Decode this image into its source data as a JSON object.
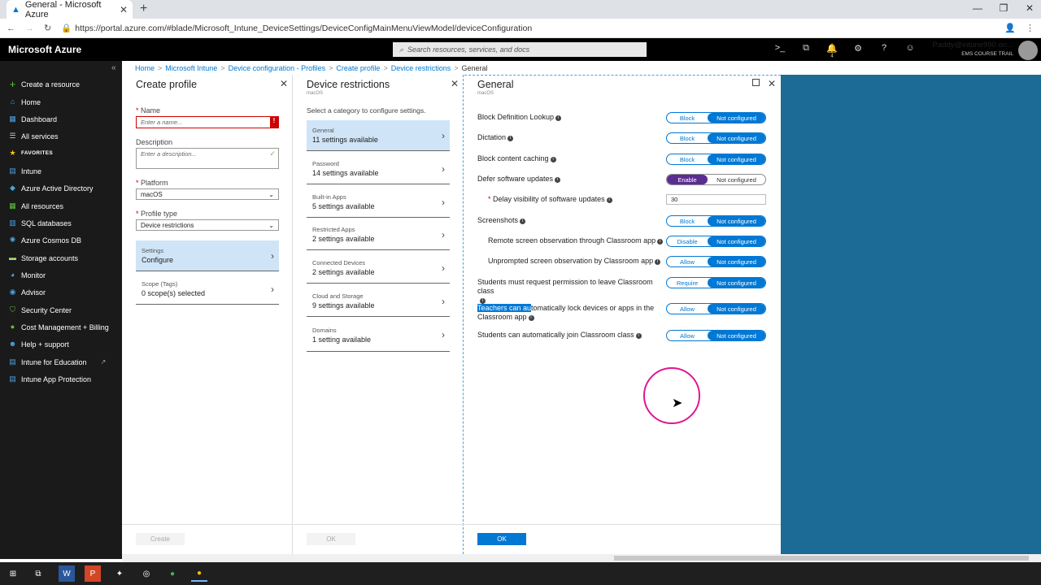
{
  "browser": {
    "tab_title": "General - Microsoft Azure",
    "url": "https://portal.azure.com/#blade/Microsoft_Intune_DeviceSettings/DeviceConfigMainMenuViewModel/deviceConfiguration"
  },
  "topbar": {
    "brand": "Microsoft Azure",
    "search_placeholder": "Search resources, services, and docs",
    "notification_count": "4",
    "user": "Paddy@intune990.on...",
    "tenant": "EMS COURSE TRAIL"
  },
  "leftnav": {
    "create": "Create a resource",
    "items_top": [
      "Home",
      "Dashboard",
      "All services"
    ],
    "favorites_label": "FAVORITES",
    "items": [
      "Intune",
      "Azure Active Directory",
      "All resources",
      "SQL databases",
      "Azure Cosmos DB",
      "Storage accounts",
      "Monitor",
      "Advisor",
      "Security Center",
      "Cost Management + Billing",
      "Help + support",
      "Intune for Education",
      "Intune App Protection"
    ]
  },
  "breadcrumb": [
    "Home",
    "Microsoft Intune",
    "Device configuration - Profiles",
    "Create profile",
    "Device restrictions",
    "General"
  ],
  "create_profile": {
    "title": "Create profile",
    "name_label": "Name",
    "name_placeholder": "Enter a name...",
    "description_label": "Description",
    "description_placeholder": "Enter a description...",
    "platform_label": "Platform",
    "platform_value": "macOS",
    "profile_type_label": "Profile type",
    "profile_type_value": "Device restrictions",
    "settings_title": "Settings",
    "settings_value": "Configure",
    "scope_title": "Scope (Tags)",
    "scope_value": "0 scope(s) selected",
    "create_button": "Create"
  },
  "device_restrictions": {
    "title": "Device restrictions",
    "subtitle": "macOS",
    "hint": "Select a category to configure settings.",
    "categories": [
      {
        "title": "General",
        "value": "11 settings available"
      },
      {
        "title": "Password",
        "value": "14 settings available"
      },
      {
        "title": "Built-in Apps",
        "value": "5 settings available"
      },
      {
        "title": "Restricted Apps",
        "value": "2 settings available"
      },
      {
        "title": "Connected Devices",
        "value": "2 settings available"
      },
      {
        "title": "Cloud and Storage",
        "value": "9 settings available"
      },
      {
        "title": "Domains",
        "value": "1 setting available"
      }
    ],
    "ok_button": "OK"
  },
  "general": {
    "title": "General",
    "subtitle": "macOS",
    "not_configured": "Not configured",
    "settings": [
      {
        "label": "Block Definition Lookup",
        "option": "Block"
      },
      {
        "label": "Dictation",
        "option": "Block"
      },
      {
        "label": "Block content caching",
        "option": "Block"
      },
      {
        "label": "Defer software updates",
        "option": "Enable"
      },
      {
        "label": "Delay visibility of software updates",
        "value": "30"
      },
      {
        "label": "Screenshots",
        "option": "Block"
      },
      {
        "label": "Remote screen observation through Classroom app",
        "option": "Disable"
      },
      {
        "label": "Unprompted screen observation by Classroom app",
        "option": "Allow"
      },
      {
        "label": "Students must request permission to leave Classroom class",
        "option": "Require"
      },
      {
        "label_hl": "Teachers can au",
        "label_rest": "tomatically lock devices or apps in the",
        "label2": "Classroom app",
        "option": "Allow"
      },
      {
        "label": "Students can automatically join Classroom class",
        "option": "Allow"
      }
    ],
    "ok_button": "OK"
  }
}
